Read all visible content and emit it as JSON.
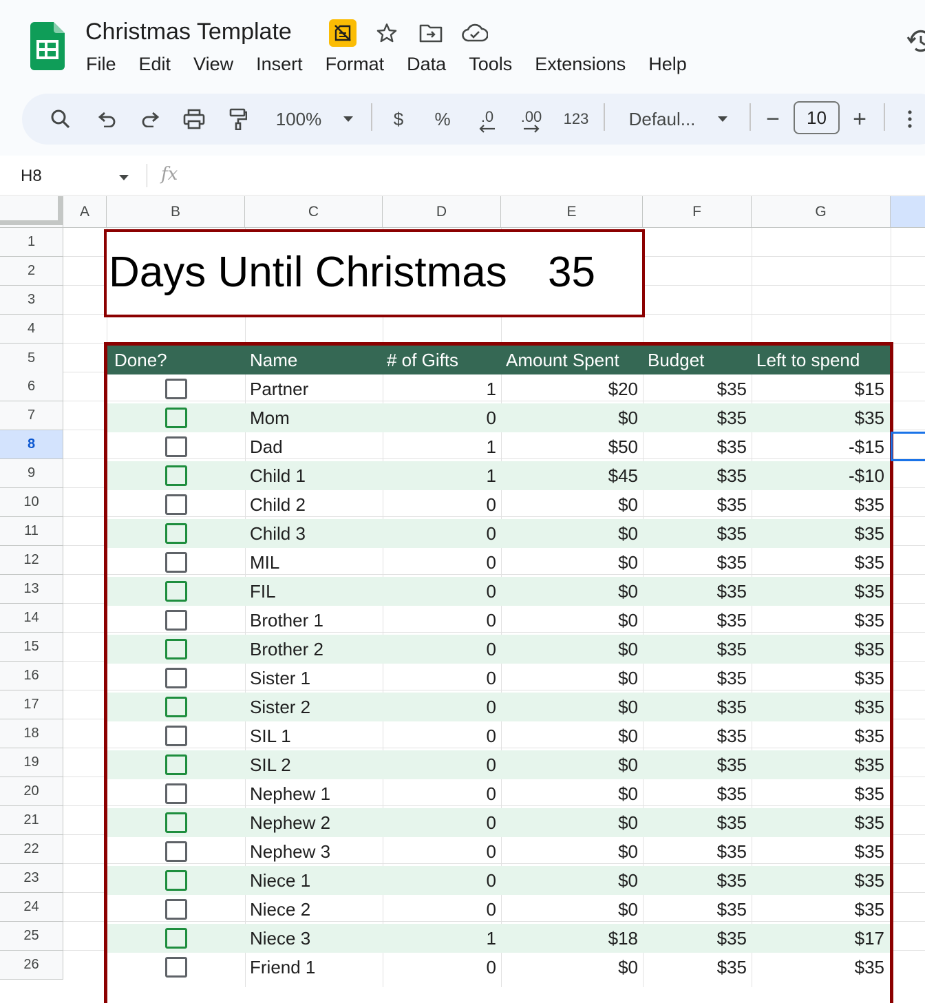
{
  "app": {
    "title": "Christmas Template",
    "menu": [
      "File",
      "Edit",
      "View",
      "Insert",
      "Format",
      "Data",
      "Tools",
      "Extensions",
      "Help"
    ]
  },
  "toolbar": {
    "zoom": "100%",
    "currency": "$",
    "percent": "%",
    "decrease_decimal": ".0",
    "increase_decimal": ".00",
    "number_format": "123",
    "font": "Defaul...",
    "font_size": "10",
    "minus": "−",
    "plus": "+"
  },
  "formula_bar": {
    "cell_ref": "H8",
    "fx_label": "fx",
    "value": ""
  },
  "columns": [
    "A",
    "B",
    "C",
    "D",
    "E",
    "F",
    "G"
  ],
  "rows": [
    "1",
    "2",
    "3",
    "4",
    "5",
    "6",
    "7",
    "8",
    "9",
    "10",
    "11",
    "12",
    "13",
    "14",
    "15",
    "16",
    "17",
    "18",
    "19",
    "20",
    "21",
    "22",
    "23",
    "24",
    "25",
    "26"
  ],
  "selected_row": "8",
  "days_until": {
    "label": "Days Until Christmas",
    "value": "35"
  },
  "table": {
    "headers": [
      "Done?",
      "Name",
      "# of Gifts",
      "Amount Spent",
      "Budget",
      "Left to spend"
    ],
    "rows": [
      {
        "name": "Partner",
        "gifts": "1",
        "spent": "$20",
        "budget": "$35",
        "left": "$15"
      },
      {
        "name": "Mom",
        "gifts": "0",
        "spent": "$0",
        "budget": "$35",
        "left": "$35"
      },
      {
        "name": "Dad",
        "gifts": "1",
        "spent": "$50",
        "budget": "$35",
        "left": "-$15"
      },
      {
        "name": "Child 1",
        "gifts": "1",
        "spent": "$45",
        "budget": "$35",
        "left": "-$10"
      },
      {
        "name": "Child 2",
        "gifts": "0",
        "spent": "$0",
        "budget": "$35",
        "left": "$35"
      },
      {
        "name": "Child 3",
        "gifts": "0",
        "spent": "$0",
        "budget": "$35",
        "left": "$35"
      },
      {
        "name": "MIL",
        "gifts": "0",
        "spent": "$0",
        "budget": "$35",
        "left": "$35"
      },
      {
        "name": "FIL",
        "gifts": "0",
        "spent": "$0",
        "budget": "$35",
        "left": "$35"
      },
      {
        "name": "Brother 1",
        "gifts": "0",
        "spent": "$0",
        "budget": "$35",
        "left": "$35"
      },
      {
        "name": "Brother 2",
        "gifts": "0",
        "spent": "$0",
        "budget": "$35",
        "left": "$35"
      },
      {
        "name": "Sister 1",
        "gifts": "0",
        "spent": "$0",
        "budget": "$35",
        "left": "$35"
      },
      {
        "name": "Sister 2",
        "gifts": "0",
        "spent": "$0",
        "budget": "$35",
        "left": "$35"
      },
      {
        "name": "SIL 1",
        "gifts": "0",
        "spent": "$0",
        "budget": "$35",
        "left": "$35"
      },
      {
        "name": "SIL 2",
        "gifts": "0",
        "spent": "$0",
        "budget": "$35",
        "left": "$35"
      },
      {
        "name": "Nephew 1",
        "gifts": "0",
        "spent": "$0",
        "budget": "$35",
        "left": "$35"
      },
      {
        "name": "Nephew 2",
        "gifts": "0",
        "spent": "$0",
        "budget": "$35",
        "left": "$35"
      },
      {
        "name": "Nephew 3",
        "gifts": "0",
        "spent": "$0",
        "budget": "$35",
        "left": "$35"
      },
      {
        "name": "Niece 1",
        "gifts": "0",
        "spent": "$0",
        "budget": "$35",
        "left": "$35"
      },
      {
        "name": "Niece 2",
        "gifts": "0",
        "spent": "$0",
        "budget": "$35",
        "left": "$35"
      },
      {
        "name": "Niece 3",
        "gifts": "1",
        "spent": "$18",
        "budget": "$35",
        "left": "$17"
      },
      {
        "name": "Friend 1",
        "gifts": "0",
        "spent": "$0",
        "budget": "$35",
        "left": "$35"
      }
    ]
  },
  "colors": {
    "header_green": "#356854",
    "alt_row": "#e6f5ec",
    "border_red": "#8b0000",
    "selection_blue": "#1a73e8"
  }
}
